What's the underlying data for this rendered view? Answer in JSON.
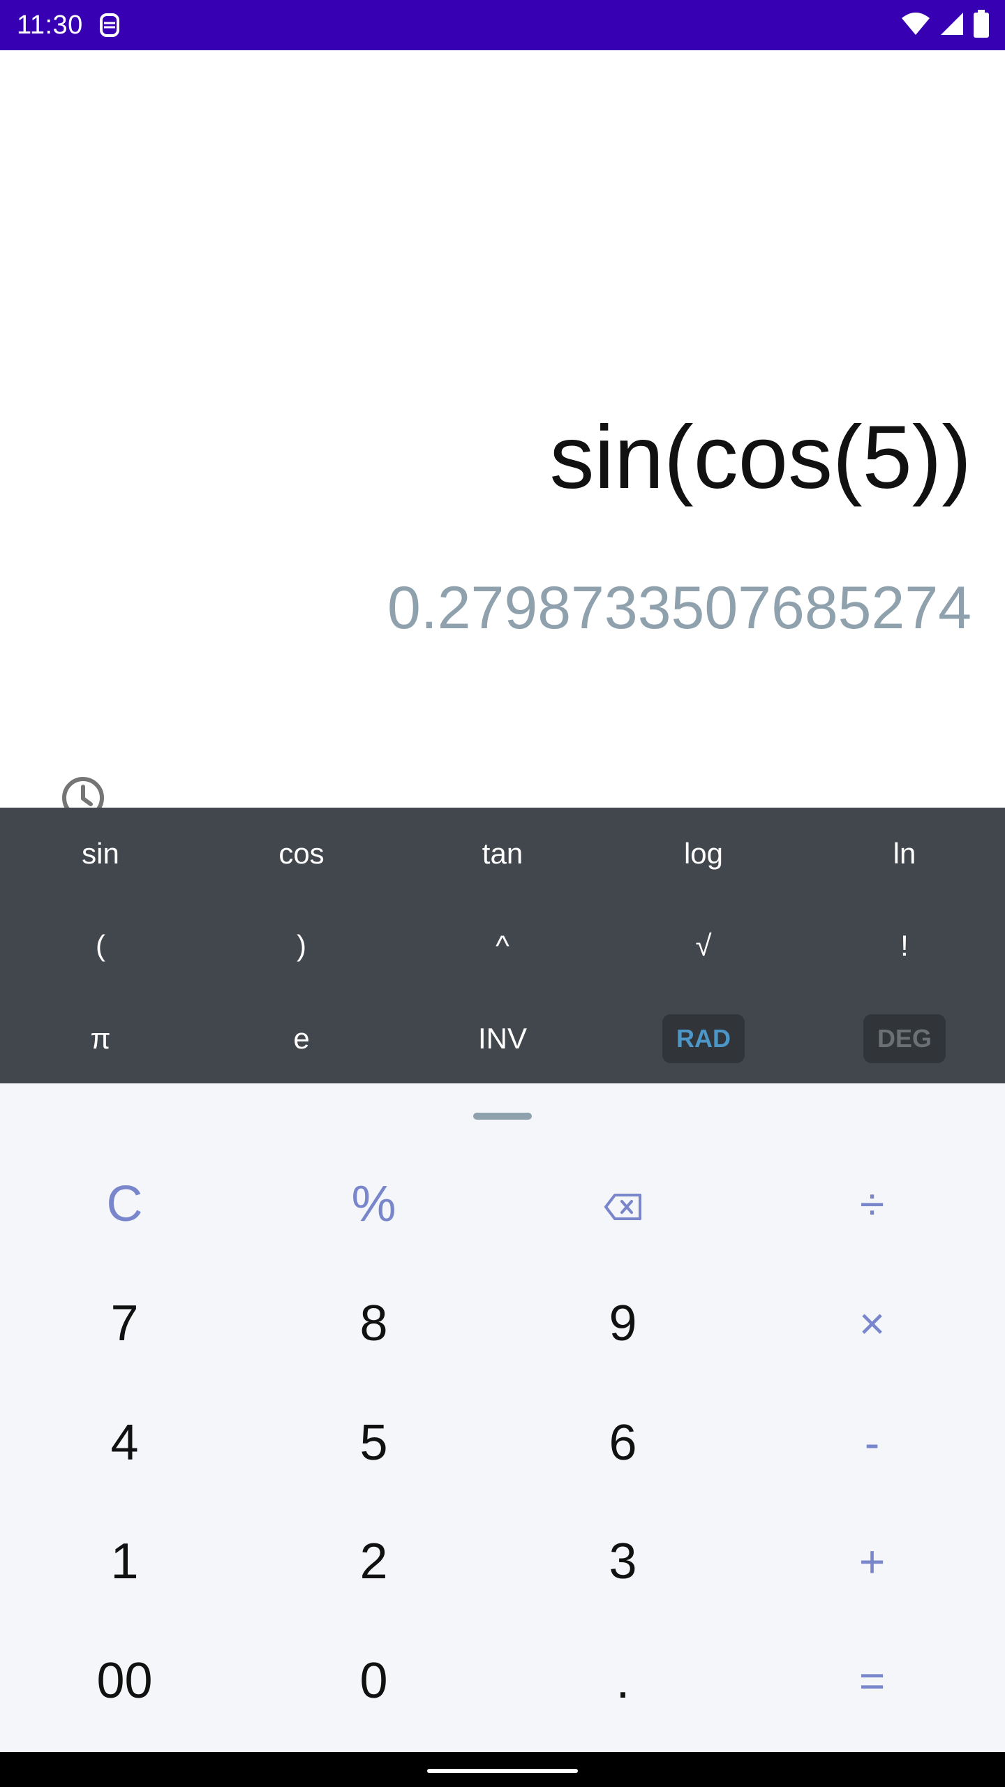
{
  "status_bar": {
    "time": "11:30",
    "icons": [
      "notification-icon",
      "wifi-icon",
      "signal-icon",
      "battery-icon"
    ],
    "background": "#3700b3"
  },
  "display": {
    "expression": "sin(cos(5))",
    "result": "0.2798733507685274",
    "history_icon": "history-icon"
  },
  "scientific": {
    "row1": [
      "sin",
      "cos",
      "tan",
      "log",
      "ln"
    ],
    "row2": [
      "(",
      ")",
      "^",
      "√",
      "!"
    ],
    "row3": [
      "π",
      "e",
      "INV",
      "RAD",
      "DEG"
    ],
    "active_mode": "RAD"
  },
  "keypad": {
    "row1": [
      "C",
      "%",
      "backspace",
      "÷"
    ],
    "row2": [
      "7",
      "8",
      "9",
      "×"
    ],
    "row3": [
      "4",
      "5",
      "6",
      "-"
    ],
    "row4": [
      "1",
      "2",
      "3",
      "+"
    ],
    "row5": [
      "00",
      "0",
      ".",
      "="
    ]
  },
  "colors": {
    "accent": "#7986cb",
    "result_text": "#8fa1ac",
    "sci_panel": "#42464d",
    "keypad_bg": "#f4f6fa",
    "rad_active": "#4c96c8"
  }
}
